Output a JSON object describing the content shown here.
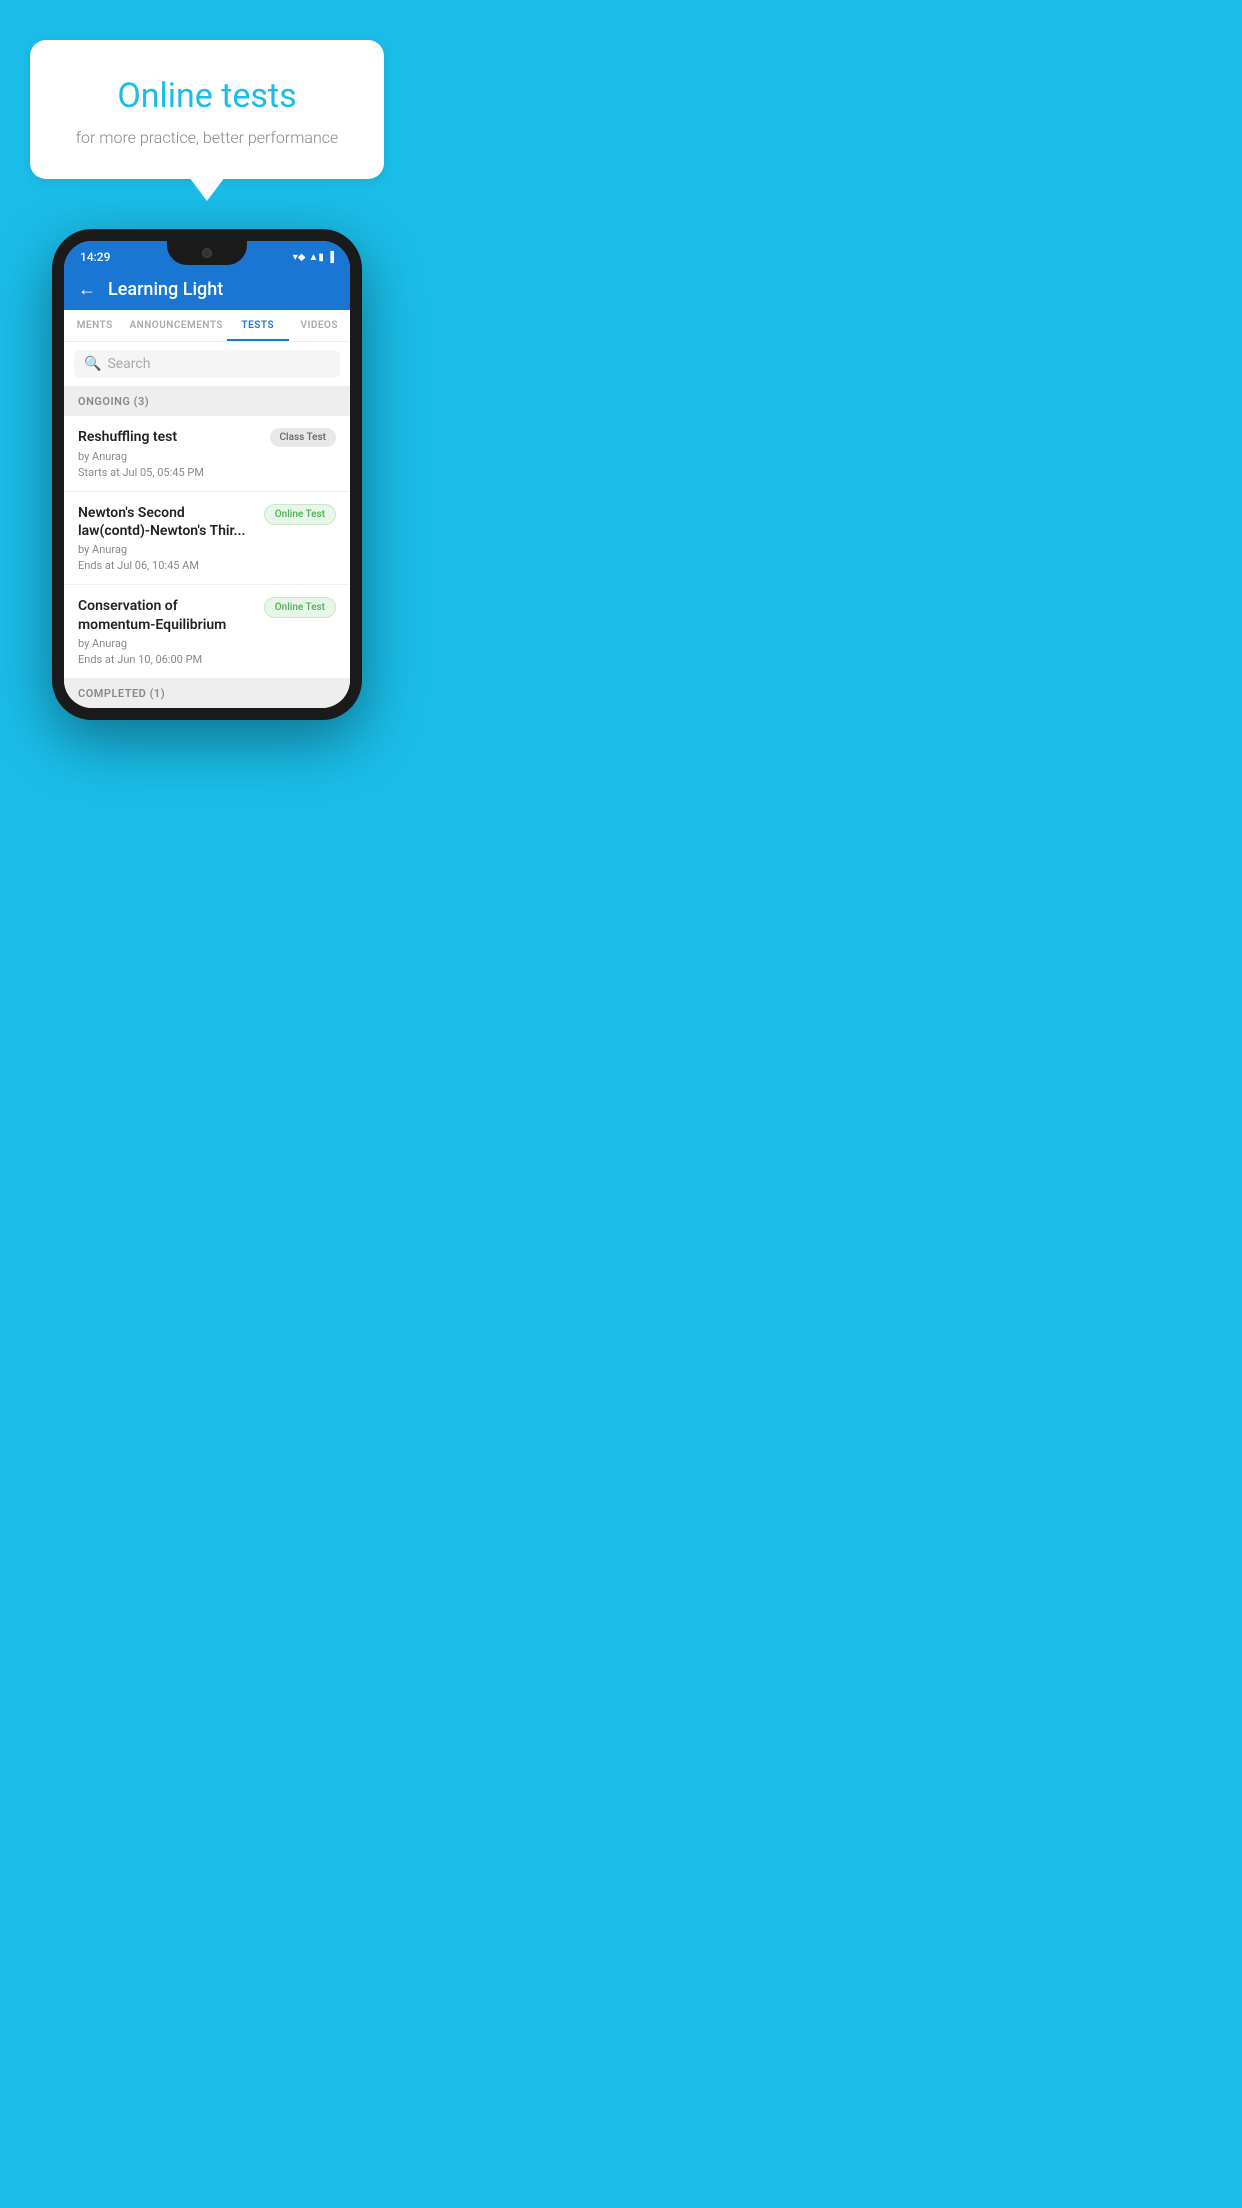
{
  "hero": {
    "bubble_title": "Online tests",
    "bubble_subtitle": "for more practice, better performance"
  },
  "phone": {
    "status_bar": {
      "time": "14:29",
      "wifi": "▼",
      "signal": "▲",
      "battery": "▐"
    },
    "app_bar": {
      "title": "Learning Light",
      "back_label": "←"
    },
    "tabs": [
      {
        "label": "MENTS",
        "active": false
      },
      {
        "label": "ANNOUNCEMENTS",
        "active": false
      },
      {
        "label": "TESTS",
        "active": true
      },
      {
        "label": "VIDEOS",
        "active": false
      }
    ],
    "search": {
      "placeholder": "Search"
    },
    "ongoing_section": {
      "label": "ONGOING (3)"
    },
    "tests": [
      {
        "title": "Reshuffling test",
        "badge_label": "Class Test",
        "badge_type": "class",
        "by": "by Anurag",
        "time_label": "Starts at",
        "time": "Jul 05, 05:45 PM"
      },
      {
        "title": "Newton's Second law(contd)-Newton's Thir...",
        "badge_label": "Online Test",
        "badge_type": "online",
        "by": "by Anurag",
        "time_label": "Ends at",
        "time": "Jul 06, 10:45 AM"
      },
      {
        "title": "Conservation of momentum-Equilibrium",
        "badge_label": "Online Test",
        "badge_type": "online",
        "by": "by Anurag",
        "time_label": "Ends at",
        "time": "Jun 10, 06:00 PM"
      }
    ],
    "completed_section": {
      "label": "COMPLETED (1)"
    }
  },
  "colors": {
    "primary": "#1976D2",
    "accent": "#1ABDE8",
    "badge_online_bg": "#e8f5e9",
    "badge_online_text": "#4CAF50"
  }
}
